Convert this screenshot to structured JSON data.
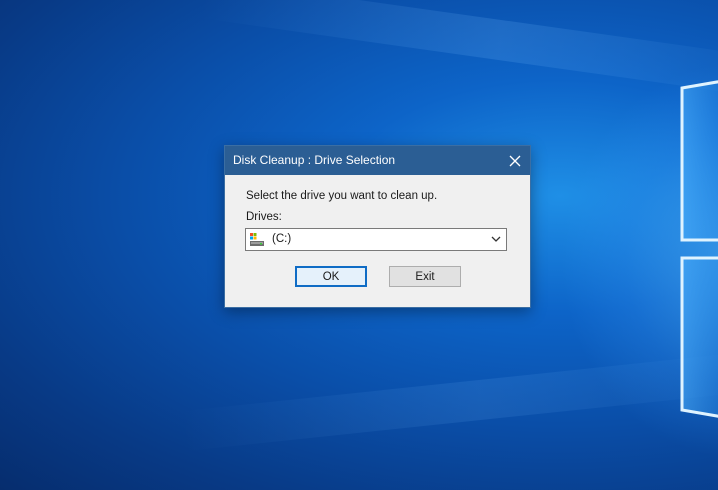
{
  "dialog": {
    "title": "Disk Cleanup : Drive Selection",
    "prompt": "Select the drive you want to clean up.",
    "drives_label": "Drives:",
    "selected_drive": "(C:)",
    "ok_label": "OK",
    "exit_label": "Exit"
  },
  "icons": {
    "close": "close-icon",
    "drive": "hard-drive-icon",
    "dropdown": "chevron-down-icon"
  },
  "colors": {
    "titlebar": "#2b5e94",
    "dialog_bg": "#f0f0f0",
    "default_button_border": "#0f6cc5",
    "desktop": "#0a4ea8"
  }
}
